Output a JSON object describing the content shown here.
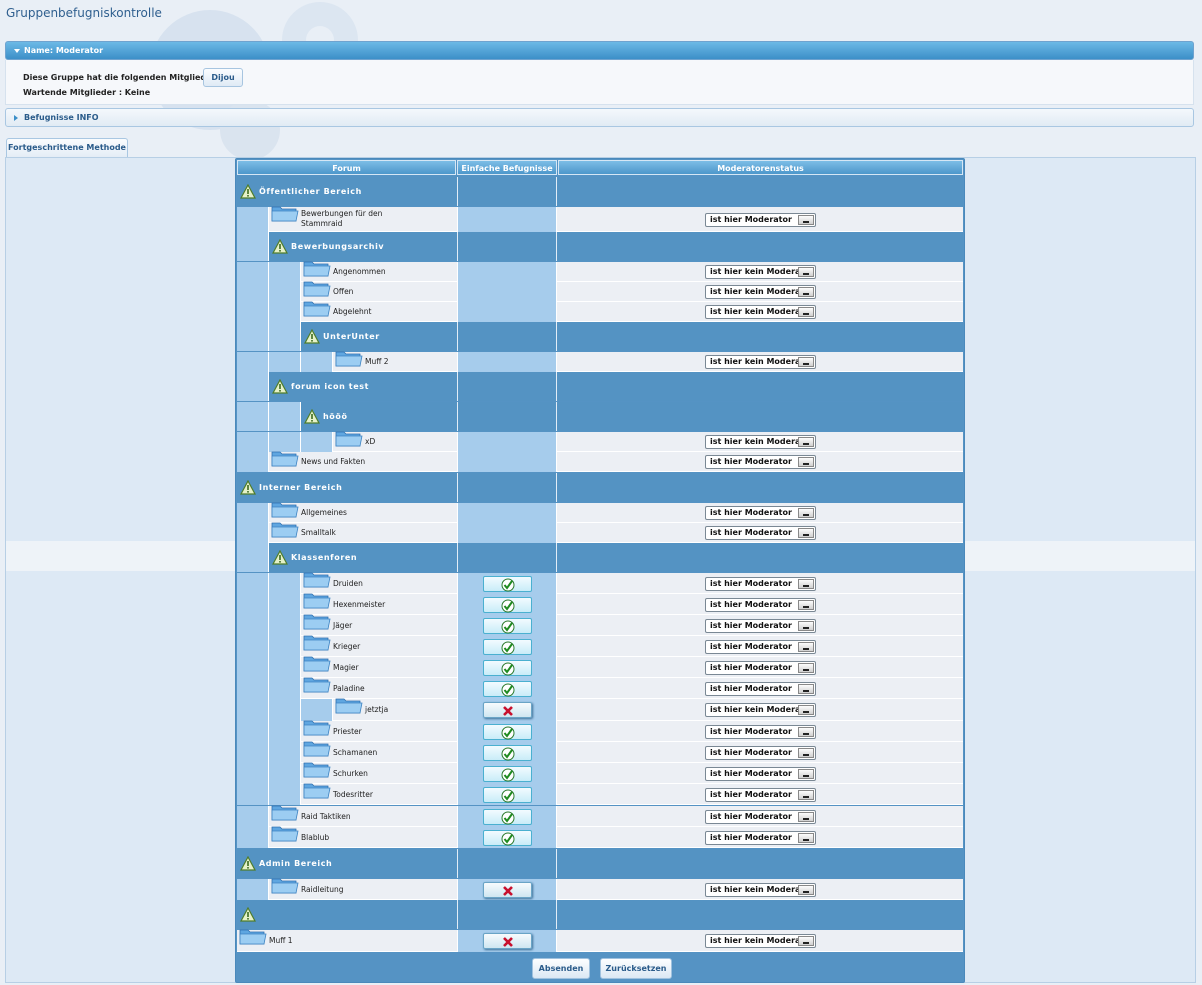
{
  "page_title": "Gruppenbefugniskontrolle",
  "name_bar": "Name: Moderator",
  "members": {
    "label": "Diese Gruppe hat die folgenden Mitglieder :",
    "member_button": "Dijou",
    "waiting": "Wartende Mitglieder : Keine"
  },
  "info_bar": "Befugnisse INFO",
  "advanced_tab": "Fortgeschrittene Methode",
  "table": {
    "headers": [
      "Forum",
      "Einfache Befugnisse",
      "Moderatorenstatus"
    ],
    "categories": [
      "Öffentlicher Bereich",
      "Bewerbungsarchiv",
      "UnterUnter",
      "forum icon test",
      "hööö",
      "Interner Bereich",
      "Klassenforen",
      "Admin Bereich",
      ""
    ],
    "forums": [
      {
        "label": "Bewerbungen für den Stammraid",
        "status": "ist hier Moderator",
        "perm": ""
      },
      {
        "label": "Angenommen",
        "status": "ist hier kein Moderator",
        "perm": ""
      },
      {
        "label": "Offen",
        "status": "ist hier kein Moderator",
        "perm": ""
      },
      {
        "label": "Abgelehnt",
        "status": "ist hier kein Moderator",
        "perm": ""
      },
      {
        "label": "Muff 2",
        "status": "ist hier kein Moderator",
        "perm": ""
      },
      {
        "label": "xD",
        "status": "ist hier kein Moderator",
        "perm": ""
      },
      {
        "label": "News und Fakten",
        "status": "ist hier Moderator",
        "perm": ""
      },
      {
        "label": "Allgemeines",
        "status": "ist hier Moderator",
        "perm": ""
      },
      {
        "label": "Smalltalk",
        "status": "ist hier Moderator",
        "perm": ""
      },
      {
        "label": "Druiden",
        "status": "ist hier Moderator",
        "perm": "yes"
      },
      {
        "label": "Hexenmeister",
        "status": "ist hier Moderator",
        "perm": "yes"
      },
      {
        "label": "Jäger",
        "status": "ist hier Moderator",
        "perm": "yes"
      },
      {
        "label": "Krieger",
        "status": "ist hier Moderator",
        "perm": "yes"
      },
      {
        "label": "Magier",
        "status": "ist hier Moderator",
        "perm": "yes"
      },
      {
        "label": "Paladine",
        "status": "ist hier Moderator",
        "perm": "yes"
      },
      {
        "label": "jetztja",
        "status": "ist hier kein Moderator",
        "perm": "no"
      },
      {
        "label": "Priester",
        "status": "ist hier Moderator",
        "perm": "yes"
      },
      {
        "label": "Schamanen",
        "status": "ist hier Moderator",
        "perm": "yes"
      },
      {
        "label": "Schurken",
        "status": "ist hier Moderator",
        "perm": "yes"
      },
      {
        "label": "Todesritter",
        "status": "ist hier Moderator",
        "perm": "yes"
      },
      {
        "label": "Raid Taktiken",
        "status": "ist hier Moderator",
        "perm": "yes"
      },
      {
        "label": "Blablub",
        "status": "ist hier Moderator",
        "perm": "yes"
      },
      {
        "label": "Raidleitung",
        "status": "ist hier kein Moderator",
        "perm": "no"
      },
      {
        "label": "Muff 1",
        "status": "ist hier kein Moderator",
        "perm": "no"
      }
    ]
  },
  "buttons": {
    "submit": "Absenden",
    "reset": "Zurücksetzen"
  }
}
